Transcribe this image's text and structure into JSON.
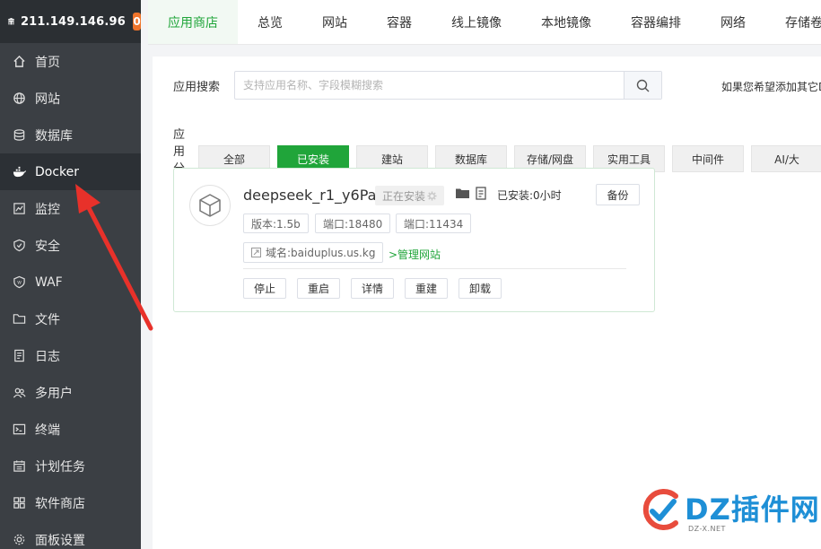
{
  "sidebar": {
    "server_ip": "211.149.146.96",
    "badge": "0",
    "items": [
      {
        "label": "首页",
        "icon": "home-icon"
      },
      {
        "label": "网站",
        "icon": "globe-icon"
      },
      {
        "label": "数据库",
        "icon": "database-icon"
      },
      {
        "label": "Docker",
        "icon": "docker-icon"
      },
      {
        "label": "监控",
        "icon": "monitor-icon"
      },
      {
        "label": "安全",
        "icon": "shield-icon"
      },
      {
        "label": "WAF",
        "icon": "waf-icon"
      },
      {
        "label": "文件",
        "icon": "folder-icon"
      },
      {
        "label": "日志",
        "icon": "log-icon"
      },
      {
        "label": "多用户",
        "icon": "users-icon"
      },
      {
        "label": "终端",
        "icon": "terminal-icon"
      },
      {
        "label": "计划任务",
        "icon": "calendar-icon"
      },
      {
        "label": "软件商店",
        "icon": "grid-icon"
      },
      {
        "label": "面板设置",
        "icon": "settings-icon"
      }
    ],
    "active_index": 3
  },
  "tabs": [
    "应用商店",
    "总览",
    "网站",
    "容器",
    "线上镜像",
    "本地镜像",
    "容器编排",
    "网络",
    "存储卷"
  ],
  "search": {
    "label": "应用搜索",
    "placeholder": "支持应用名称、字段模糊搜索",
    "hint": "如果您希望添加其它D"
  },
  "categories": {
    "label": "应用分类",
    "items": [
      "全部",
      "已安装",
      "建站",
      "数据库",
      "存储/网盘",
      "实用工具",
      "中间件",
      "AI/大"
    ],
    "active_index": 1
  },
  "app": {
    "name": "deepseek_r1_y6Pa",
    "status": "正在安装",
    "installed": "已安装:0小时",
    "backup": "备份",
    "version": "版本:1.5b",
    "port1": "端口:18480",
    "port2": "端口:11434",
    "domain": "域名:baiduplus.us.kg",
    "manage_site": ">管理网站",
    "actions": [
      "停止",
      "重启",
      "详情",
      "重建",
      "卸载"
    ]
  },
  "watermark": {
    "text": "DZ插件网",
    "sub": "DZ-X.NET"
  },
  "colors": {
    "accent": "#20a53a",
    "sidebar_bg": "#3b3f44",
    "badge": "#f0742a",
    "arrow": "#e8312a"
  }
}
